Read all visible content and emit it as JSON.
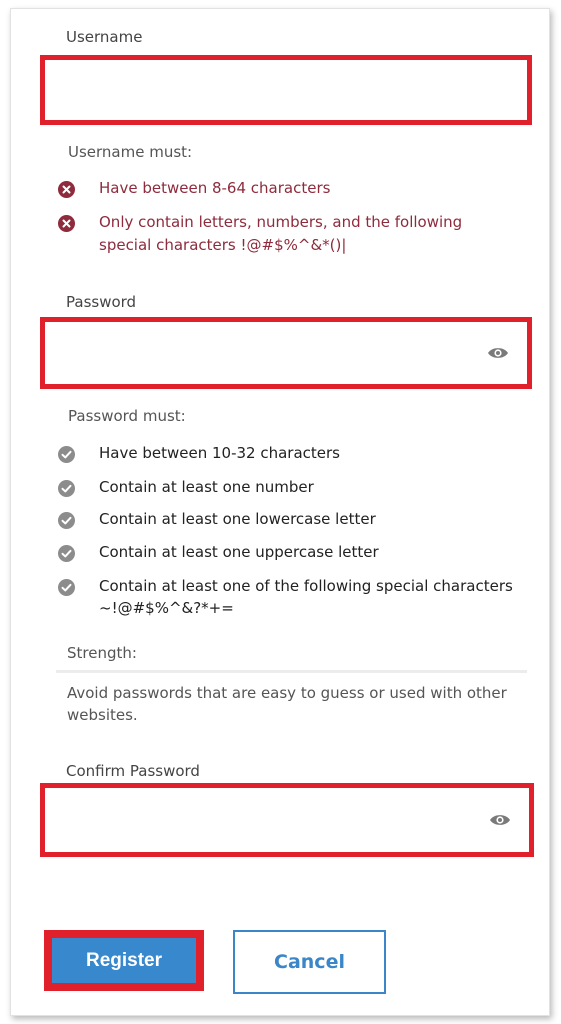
{
  "form": {
    "username": {
      "label": "Username",
      "value": "",
      "rules_title": "Username must:",
      "rules": [
        "Have between 8-64 characters",
        "Only contain letters, numbers, and the following",
        "special characters !@#$%^&*()|"
      ]
    },
    "password": {
      "label": "Password",
      "value": "",
      "rules_title": "Password must:",
      "rules": [
        "Have between 10-32 characters",
        "Contain at least one number",
        "Contain at least one lowercase letter",
        "Contain at least one uppercase letter",
        "Contain at least one of the following special characters",
        "~!@#$%^&?*+="
      ],
      "strength_label": "Strength:",
      "advice_line1": "Avoid passwords that are easy to guess or used with other",
      "advice_line2": "websites."
    },
    "confirm_password": {
      "label": "Confirm Password",
      "value": ""
    }
  },
  "buttons": {
    "register": "Register",
    "cancel": "Cancel"
  },
  "icons": {
    "error": "x-circle-icon",
    "check": "check-circle-icon",
    "eye": "eye-icon"
  },
  "colors": {
    "error": "#8e2b3c",
    "check": "#8c8c8c",
    "highlight": "#e0202a",
    "primary": "#3788cc"
  }
}
